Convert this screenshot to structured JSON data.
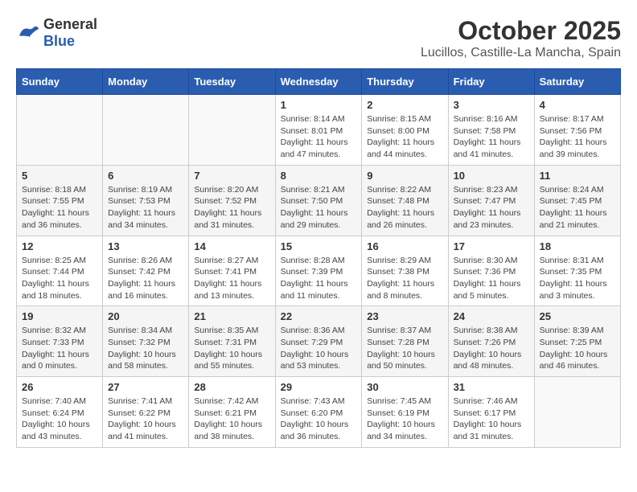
{
  "header": {
    "logo_general": "General",
    "logo_blue": "Blue",
    "month": "October 2025",
    "location": "Lucillos, Castille-La Mancha, Spain"
  },
  "weekdays": [
    "Sunday",
    "Monday",
    "Tuesday",
    "Wednesday",
    "Thursday",
    "Friday",
    "Saturday"
  ],
  "weeks": [
    [
      {
        "day": "",
        "info": ""
      },
      {
        "day": "",
        "info": ""
      },
      {
        "day": "",
        "info": ""
      },
      {
        "day": "1",
        "info": "Sunrise: 8:14 AM\nSunset: 8:01 PM\nDaylight: 11 hours\nand 47 minutes."
      },
      {
        "day": "2",
        "info": "Sunrise: 8:15 AM\nSunset: 8:00 PM\nDaylight: 11 hours\nand 44 minutes."
      },
      {
        "day": "3",
        "info": "Sunrise: 8:16 AM\nSunset: 7:58 PM\nDaylight: 11 hours\nand 41 minutes."
      },
      {
        "day": "4",
        "info": "Sunrise: 8:17 AM\nSunset: 7:56 PM\nDaylight: 11 hours\nand 39 minutes."
      }
    ],
    [
      {
        "day": "5",
        "info": "Sunrise: 8:18 AM\nSunset: 7:55 PM\nDaylight: 11 hours\nand 36 minutes."
      },
      {
        "day": "6",
        "info": "Sunrise: 8:19 AM\nSunset: 7:53 PM\nDaylight: 11 hours\nand 34 minutes."
      },
      {
        "day": "7",
        "info": "Sunrise: 8:20 AM\nSunset: 7:52 PM\nDaylight: 11 hours\nand 31 minutes."
      },
      {
        "day": "8",
        "info": "Sunrise: 8:21 AM\nSunset: 7:50 PM\nDaylight: 11 hours\nand 29 minutes."
      },
      {
        "day": "9",
        "info": "Sunrise: 8:22 AM\nSunset: 7:48 PM\nDaylight: 11 hours\nand 26 minutes."
      },
      {
        "day": "10",
        "info": "Sunrise: 8:23 AM\nSunset: 7:47 PM\nDaylight: 11 hours\nand 23 minutes."
      },
      {
        "day": "11",
        "info": "Sunrise: 8:24 AM\nSunset: 7:45 PM\nDaylight: 11 hours\nand 21 minutes."
      }
    ],
    [
      {
        "day": "12",
        "info": "Sunrise: 8:25 AM\nSunset: 7:44 PM\nDaylight: 11 hours\nand 18 minutes."
      },
      {
        "day": "13",
        "info": "Sunrise: 8:26 AM\nSunset: 7:42 PM\nDaylight: 11 hours\nand 16 minutes."
      },
      {
        "day": "14",
        "info": "Sunrise: 8:27 AM\nSunset: 7:41 PM\nDaylight: 11 hours\nand 13 minutes."
      },
      {
        "day": "15",
        "info": "Sunrise: 8:28 AM\nSunset: 7:39 PM\nDaylight: 11 hours\nand 11 minutes."
      },
      {
        "day": "16",
        "info": "Sunrise: 8:29 AM\nSunset: 7:38 PM\nDaylight: 11 hours\nand 8 minutes."
      },
      {
        "day": "17",
        "info": "Sunrise: 8:30 AM\nSunset: 7:36 PM\nDaylight: 11 hours\nand 5 minutes."
      },
      {
        "day": "18",
        "info": "Sunrise: 8:31 AM\nSunset: 7:35 PM\nDaylight: 11 hours\nand 3 minutes."
      }
    ],
    [
      {
        "day": "19",
        "info": "Sunrise: 8:32 AM\nSunset: 7:33 PM\nDaylight: 11 hours\nand 0 minutes."
      },
      {
        "day": "20",
        "info": "Sunrise: 8:34 AM\nSunset: 7:32 PM\nDaylight: 10 hours\nand 58 minutes."
      },
      {
        "day": "21",
        "info": "Sunrise: 8:35 AM\nSunset: 7:31 PM\nDaylight: 10 hours\nand 55 minutes."
      },
      {
        "day": "22",
        "info": "Sunrise: 8:36 AM\nSunset: 7:29 PM\nDaylight: 10 hours\nand 53 minutes."
      },
      {
        "day": "23",
        "info": "Sunrise: 8:37 AM\nSunset: 7:28 PM\nDaylight: 10 hours\nand 50 minutes."
      },
      {
        "day": "24",
        "info": "Sunrise: 8:38 AM\nSunset: 7:26 PM\nDaylight: 10 hours\nand 48 minutes."
      },
      {
        "day": "25",
        "info": "Sunrise: 8:39 AM\nSunset: 7:25 PM\nDaylight: 10 hours\nand 46 minutes."
      }
    ],
    [
      {
        "day": "26",
        "info": "Sunrise: 7:40 AM\nSunset: 6:24 PM\nDaylight: 10 hours\nand 43 minutes."
      },
      {
        "day": "27",
        "info": "Sunrise: 7:41 AM\nSunset: 6:22 PM\nDaylight: 10 hours\nand 41 minutes."
      },
      {
        "day": "28",
        "info": "Sunrise: 7:42 AM\nSunset: 6:21 PM\nDaylight: 10 hours\nand 38 minutes."
      },
      {
        "day": "29",
        "info": "Sunrise: 7:43 AM\nSunset: 6:20 PM\nDaylight: 10 hours\nand 36 minutes."
      },
      {
        "day": "30",
        "info": "Sunrise: 7:45 AM\nSunset: 6:19 PM\nDaylight: 10 hours\nand 34 minutes."
      },
      {
        "day": "31",
        "info": "Sunrise: 7:46 AM\nSunset: 6:17 PM\nDaylight: 10 hours\nand 31 minutes."
      },
      {
        "day": "",
        "info": ""
      }
    ]
  ]
}
